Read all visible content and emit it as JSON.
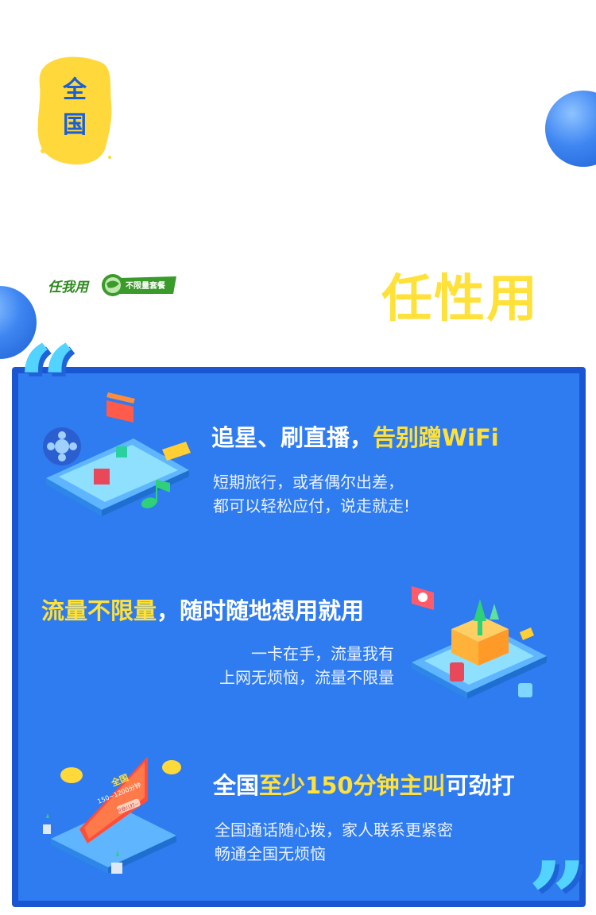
{
  "badge": {
    "line1": "全",
    "line2": "国"
  },
  "logo": {
    "brand": "任我用",
    "tag": "不限量套餐"
  },
  "headline": "任性用",
  "sections": [
    {
      "title": "追星、刷直播，",
      "title_highlight": "告别蹭WiFi",
      "lines": [
        "短期旅行，或者偶尔出差，",
        "都可以轻松应付，说走就走!"
      ]
    },
    {
      "title_highlight": "流量不限量",
      "title": "，随时随地想用就用",
      "lines": [
        "一卡在手，流量我有",
        "上网无烦恼，流量不限量"
      ]
    },
    {
      "title_pre": "全国",
      "title_highlight": "至少150分钟主叫",
      "title_post": "可劲打",
      "lines": [
        "全国通话随心拨，家人联系更紧密",
        "畅通全国无烦恼"
      ]
    }
  ],
  "illustrations": {
    "call_screen_title": "全国",
    "call_screen_sub": "150~1200分钟",
    "call_screen_btn": "可劲儿打~"
  },
  "colors": {
    "panel": "#2f7bf0",
    "panel_border": "#1b56d2",
    "highlight": "#ffe13a",
    "quote": "#53d3ff",
    "badge_bg": "#ffd93b"
  }
}
